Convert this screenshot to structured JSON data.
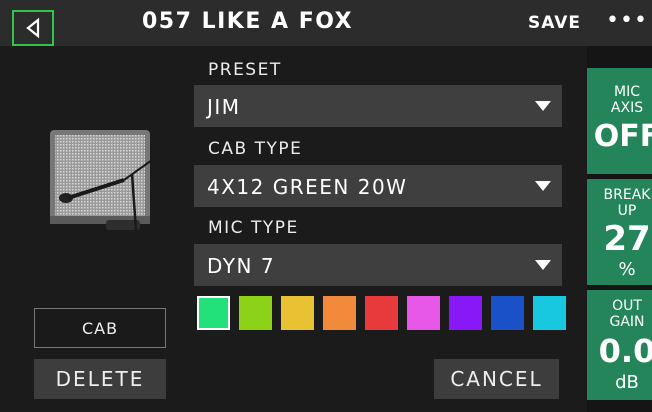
{
  "header": {
    "title": "057 LIKE A FOX",
    "save_label": "SAVE",
    "more_label": "•••"
  },
  "fields": {
    "preset": {
      "label": "PRESET",
      "value": "JIM"
    },
    "cab_type": {
      "label": "CAB TYPE",
      "value": "4X12 GREEN 20W"
    },
    "mic_type": {
      "label": "MIC TYPE",
      "value": "DYN 7"
    }
  },
  "swatches": [
    "#22e07a",
    "#8cd218",
    "#e8c232",
    "#f28a3c",
    "#e83a3c",
    "#e858e8",
    "#8818f8",
    "#1a50c8",
    "#18c8e0"
  ],
  "selected_swatch_index": 0,
  "buttons": {
    "cab_label": "CAB",
    "delete_label": "DELETE",
    "cancel_label": "CANCEL"
  },
  "knobs": [
    {
      "name_line1": "MIC",
      "name_line2": "AXIS",
      "value": "OFF",
      "unit": ""
    },
    {
      "name_line1": "BREAK",
      "name_line2": "UP",
      "value": "27",
      "unit": "%"
    },
    {
      "name_line1": "OUT",
      "name_line2": "GAIN",
      "value": "0.0",
      "unit": "dB"
    }
  ],
  "colors": {
    "accent_green": "#35c24a",
    "knob_green": "#24855a",
    "background": "#1b1b1b",
    "dropdown": "#3f3f3f"
  }
}
